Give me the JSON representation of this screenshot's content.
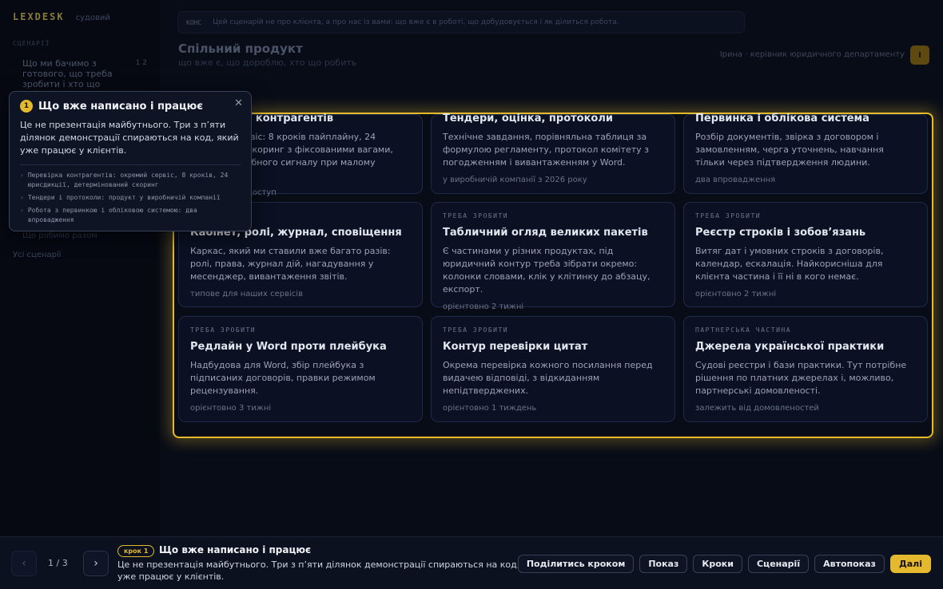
{
  "sidebar": {
    "brand": "LEXDESK",
    "brand_sub": "судовий",
    "section_label": "СЦЕНАРІЇ",
    "items": [
      {
        "label": "Що ми бачимо з готового, що треба зробити і хто що робить",
        "count": "1 2"
      }
    ],
    "bottom_1": "Що робимо разом",
    "bottom_2": "Усі сценарії"
  },
  "topbar": {
    "tag": "КОНС",
    "text": "Цей сценарій не про клієнта, а про нас із вами: що вже є в роботі, що добудовується і як ділиться робота."
  },
  "page": {
    "title": "Спільний продукт",
    "subtitle": "що вже є, що дороблю, хто що робить",
    "owner": "Ірина · керівник юридичного департаменту",
    "owner_initial": "І"
  },
  "cards": [
    {
      "kicker": "",
      "title": "Перевірка контрагентів",
      "desc": "Окремий сервіс: 8 кроків пайплайну, 24 юрисдикції, скоринг з фіксованими вагами, захист від хибного сигналу при малому покритті.",
      "meta": "комерційний доступ"
    },
    {
      "kicker": "",
      "title": "Тендери, оцінка, протоколи",
      "desc": "Технічне завдання, порівняльна таблиця за формулою регламенту, протокол комітету з погодженням і вивантаженням у Word.",
      "meta": "у виробничій компанії з 2026 року"
    },
    {
      "kicker": "",
      "title": "Первинка і облікова система",
      "desc": "Розбір документів, звірка з договором і замовленням, черга уточнень, навчання тільки через підтвердження людини.",
      "meta": "два впровадження"
    },
    {
      "kicker": "",
      "title": "Кабінет, ролі, журнал, сповіщення",
      "desc": "Каркас, який ми ставили вже багато разів: ролі, права, журнал дій, нагадування у месенджер, вивантаження звітів.",
      "meta": "типове для наших сервісів"
    },
    {
      "kicker": "треба зробити",
      "title": "Табличний огляд великих пакетів",
      "desc": "Є частинами у різних продуктах, під юридичний контур треба зібрати окремо: колонки словами, клік у клітинку до абзацу, експорт.",
      "meta": "орієнтовно 2 тижні"
    },
    {
      "kicker": "треба зробити",
      "title": "Реєстр строків і зобов’язань",
      "desc": "Витяг дат і умовних строків з договорів, календар, ескалація. Найкорисніша для клієнта частина і її ні в кого немає.",
      "meta": "орієнтовно 2 тижні"
    },
    {
      "kicker": "треба зробити",
      "title": "Редлайн у Word проти плейбука",
      "desc": "Надбудова для Word, збір плейбука з підписаних договорів, правки режимом рецензування.",
      "meta": "орієнтовно 3 тижні"
    },
    {
      "kicker": "треба зробити",
      "title": "Контур перевірки цитат",
      "desc": "Окрема перевірка кожного посилання перед видачею відповіді, з відкиданням непідтверджених.",
      "meta": "орієнтовно 1 тиждень"
    },
    {
      "kicker": "партнерська частина",
      "title": "Джерела української практики",
      "desc": "Судові реєстри і бази практики. Тут потрібне рішення по платних джерелах і, можливо, партнерські домовленості.",
      "meta": "залежить від домовленостей"
    }
  ],
  "popover": {
    "number": "1",
    "title": "Що вже написано і працює",
    "close_icon": "close-icon",
    "text": "Це не презентація майбутнього. Три з п’яти ділянок демонстрації спираються на код, який уже працює у клієнтів.",
    "bullets": [
      "Перевірка контрагентів: окремий сервіс, 8 кроків, 24 юрисдикції, детермінований скоринг",
      "Тендери і протоколи: продукт у виробничій компанії",
      "Робота з первинкою і обліковою системою: два впровадження"
    ]
  },
  "bottombar": {
    "prev_icon": "‹",
    "next_icon": "›",
    "counter": "1 / 3",
    "step_badge": "крок 1",
    "step_title": "Що вже написано і працює",
    "step_text": "Це не презентація майбутнього. Три з п’яти ділянок демонстрації спираються на код, який уже працює у клієнтів.",
    "actions": [
      "Поділитись кроком",
      "Показ",
      "Кроки",
      "Сценарії",
      "Автопоказ"
    ],
    "primary": "Далі"
  },
  "colors": {
    "accent": "#e4b92d",
    "background": "#080c17",
    "card": "#0b1122"
  }
}
